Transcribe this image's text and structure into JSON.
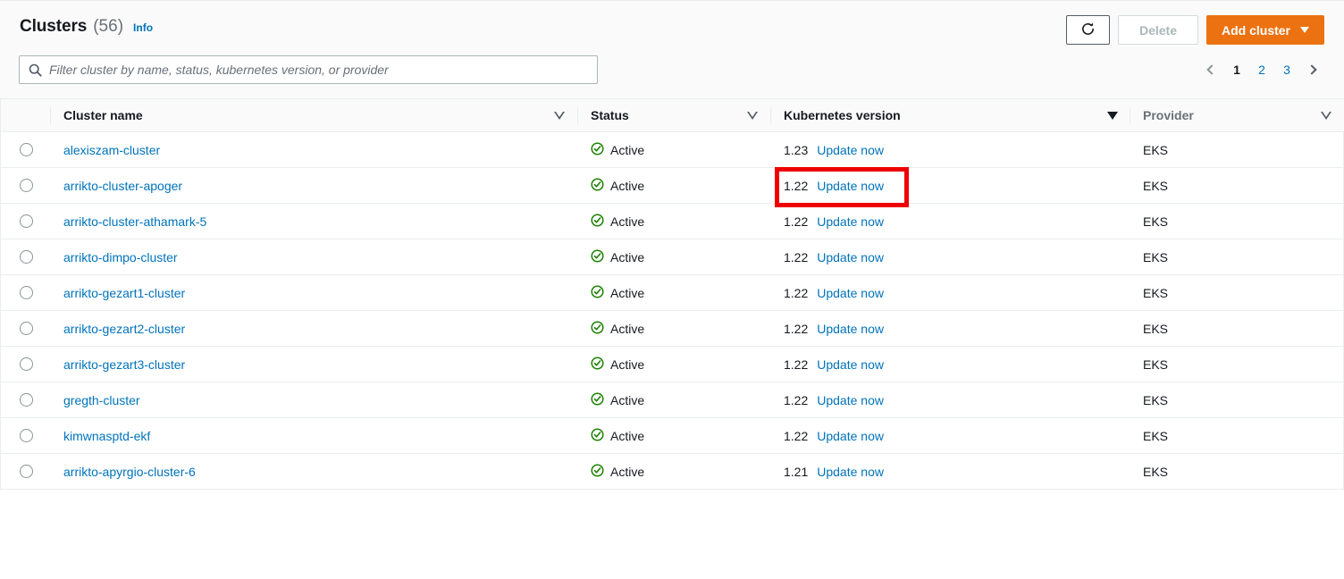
{
  "header": {
    "title": "Clusters",
    "count": "(56)",
    "info_label": "Info"
  },
  "search": {
    "placeholder": "Filter cluster by name, status, kubernetes version, or provider",
    "value": "",
    "icon": "search-icon"
  },
  "toolbar": {
    "refresh_icon": "refresh-icon",
    "delete_label": "Delete",
    "add_cluster_label": "Add cluster",
    "add_cluster_caret": "chevron-down-icon",
    "accent_color": "#ec7211"
  },
  "pagination": {
    "prev_icon": "chevron-left-icon",
    "next_icon": "chevron-right-icon",
    "pages": [
      "1",
      "2",
      "3"
    ],
    "current": "1"
  },
  "table": {
    "columns": [
      {
        "label": "",
        "sort": "none"
      },
      {
        "label": "Cluster name",
        "sort": "inactive"
      },
      {
        "label": "Status",
        "sort": "inactive"
      },
      {
        "label": "Kubernetes version",
        "sort": "active"
      },
      {
        "label": "Provider",
        "sort": "inactive"
      }
    ],
    "update_label": "Update now",
    "status_icon": "status-success-icon",
    "status_color": "#1d8102",
    "rows": [
      {
        "name": "alexiszam-cluster",
        "status": "Active",
        "version": "1.23",
        "update": "Update now",
        "provider": "EKS"
      },
      {
        "name": "arrikto-cluster-apoger",
        "status": "Active",
        "version": "1.22",
        "update": "Update now",
        "provider": "EKS"
      },
      {
        "name": "arrikto-cluster-athamark-5",
        "status": "Active",
        "version": "1.22",
        "update": "Update now",
        "provider": "EKS"
      },
      {
        "name": "arrikto-dimpo-cluster",
        "status": "Active",
        "version": "1.22",
        "update": "Update now",
        "provider": "EKS"
      },
      {
        "name": "arrikto-gezart1-cluster",
        "status": "Active",
        "version": "1.22",
        "update": "Update now",
        "provider": "EKS"
      },
      {
        "name": "arrikto-gezart2-cluster",
        "status": "Active",
        "version": "1.22",
        "update": "Update now",
        "provider": "EKS"
      },
      {
        "name": "arrikto-gezart3-cluster",
        "status": "Active",
        "version": "1.22",
        "update": "Update now",
        "provider": "EKS"
      },
      {
        "name": "gregth-cluster",
        "status": "Active",
        "version": "1.22",
        "update": "Update now",
        "provider": "EKS"
      },
      {
        "name": "kimwnasptd-ekf",
        "status": "Active",
        "version": "1.22",
        "update": "Update now",
        "provider": "EKS"
      },
      {
        "name": "arrikto-apyrgio-cluster-6",
        "status": "Active",
        "version": "1.21",
        "update": "Update now",
        "provider": "EKS"
      }
    ]
  },
  "annotation": {
    "target": "kubernetes-version-cell-row-2",
    "color": "#ee0000"
  }
}
